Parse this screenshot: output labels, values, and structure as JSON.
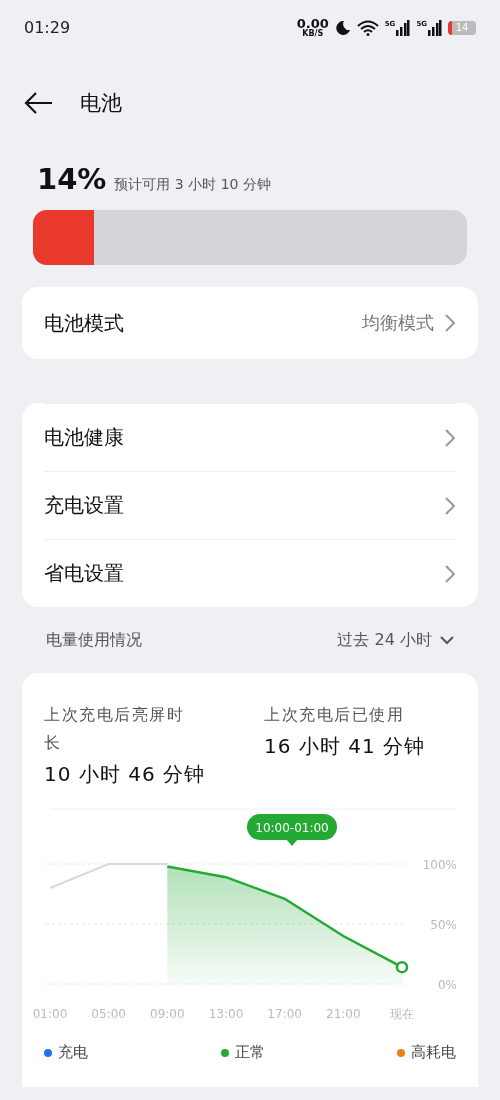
{
  "status_bar": {
    "time": "01:29",
    "net_speed": "0.00",
    "net_unit": "KB/S",
    "signal_1": "5G",
    "signal_2": "5G",
    "battery": "14"
  },
  "header": {
    "title": "电池"
  },
  "battery": {
    "percent": "14%",
    "estimate": "预计可用 3 小时 10 分钟",
    "level": 0.14
  },
  "mode_card": {
    "label": "电池模式",
    "value": "均衡模式"
  },
  "settings": [
    {
      "label": "电池健康"
    },
    {
      "label": "充电设置"
    },
    {
      "label": "省电设置"
    }
  ],
  "usage": {
    "title": "电量使用情况",
    "range": "过去 24 小时",
    "stats": [
      {
        "label": "上次充电后亮屏时长",
        "value": "10 小时 46 分钟"
      },
      {
        "label": "上次充电后已使用",
        "value": "16 小时 41 分钟"
      }
    ],
    "tooltip": "10:00-01:00",
    "chart_data": {
      "type": "area",
      "categories": [
        "01:00",
        "05:00",
        "09:00",
        "13:00",
        "17:00",
        "21:00",
        "现在"
      ],
      "ylim": [
        0,
        100
      ],
      "yticks": [
        {
          "value": 0,
          "label": "0%"
        },
        {
          "value": 50,
          "label": "50%"
        },
        {
          "value": 100,
          "label": "100%"
        }
      ],
      "series": [
        {
          "type": "line",
          "color": "#d9d9d9",
          "values": [
            80,
            100,
            100,
            null,
            null,
            null,
            null
          ]
        },
        {
          "type": "area",
          "color": "#22aa33",
          "values": [
            null,
            null,
            98,
            89,
            71,
            40,
            14
          ]
        }
      ]
    },
    "legend": [
      {
        "label": "充电",
        "color": "#1a73e8"
      },
      {
        "label": "正常",
        "color": "#22aa33"
      },
      {
        "label": "高耗电",
        "color": "#f07c1c"
      }
    ]
  }
}
